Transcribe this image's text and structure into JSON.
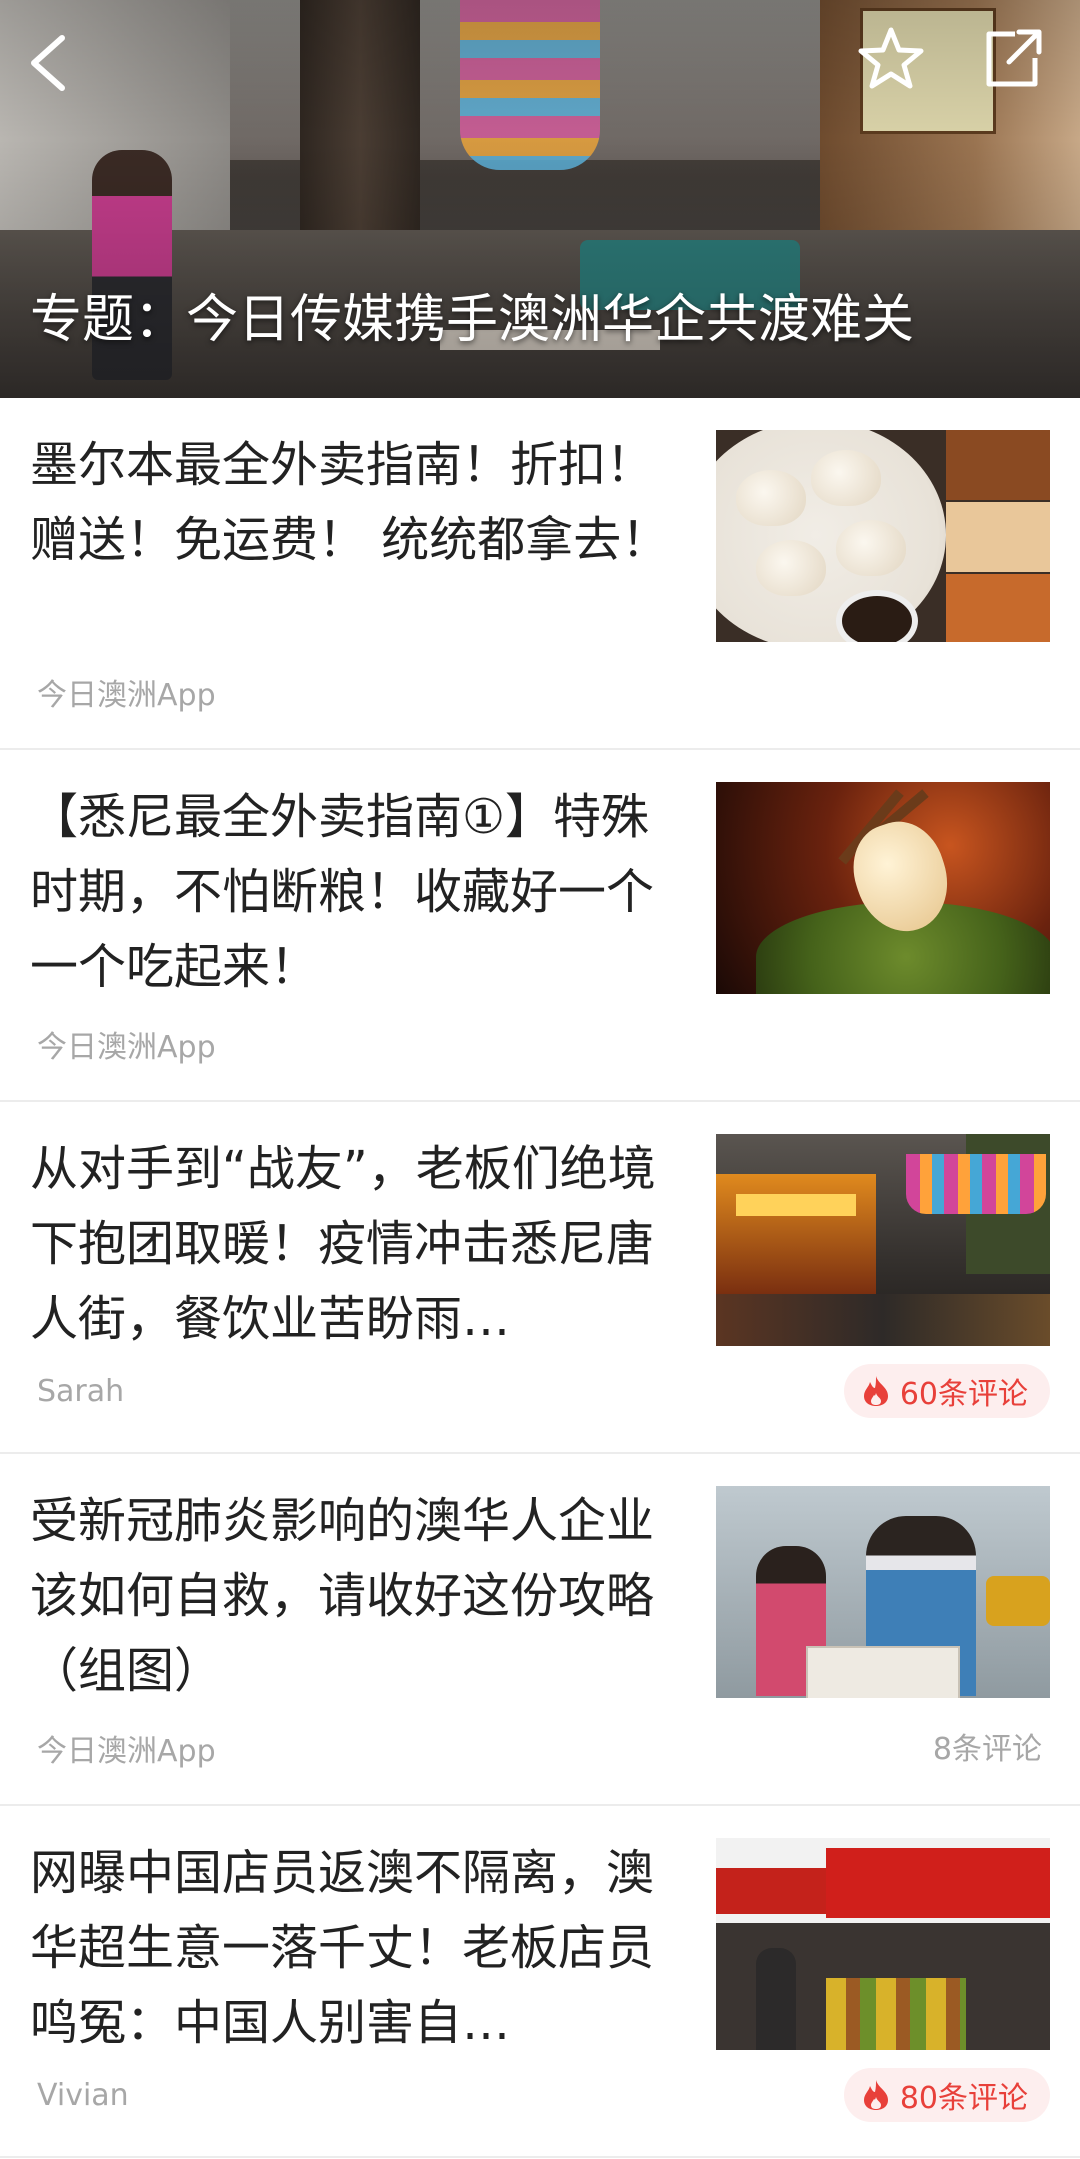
{
  "hero": {
    "title": "专题：今日传媒携手澳洲华企共渡难关"
  },
  "toolbar": {
    "back_icon": "chevron-left-icon",
    "favorite_icon": "star-outline-icon",
    "share_icon": "share-external-icon"
  },
  "colors": {
    "hot_badge_bg": "#fdeeee",
    "hot_badge_text": "#e8403a",
    "meta_text": "#a7a7a7",
    "title_text": "#222222"
  },
  "articles": [
    {
      "title": "墨尔本最全外卖指南！折扣！赠送！免运费！ 统统都拿去！",
      "source": "今日澳洲App",
      "comments": ""
    },
    {
      "title": "【悉尼最全外卖指南①】特殊时期，不怕断粮！收藏好一个一个吃起来！",
      "source": "今日澳洲App",
      "comments": ""
    },
    {
      "title": "从对手到“战友”，老板们绝境下抱团取暖！疫情冲击悉尼唐人街，餐饮业苦盼雨…",
      "source": "Sarah",
      "comments": "60条评论",
      "hot": true
    },
    {
      "title": "受新冠肺炎影响的澳华人企业该如何自救，请收好这份攻略（组图）",
      "source": "今日澳洲App",
      "comments": "8条评论"
    },
    {
      "title": "网曝中国店员返澳不隔离，澳华超生意一落千丈！老板店员鸣冤：中国人别害自…",
      "source": "Vivian",
      "comments": "80条评论",
      "hot": true
    }
  ]
}
